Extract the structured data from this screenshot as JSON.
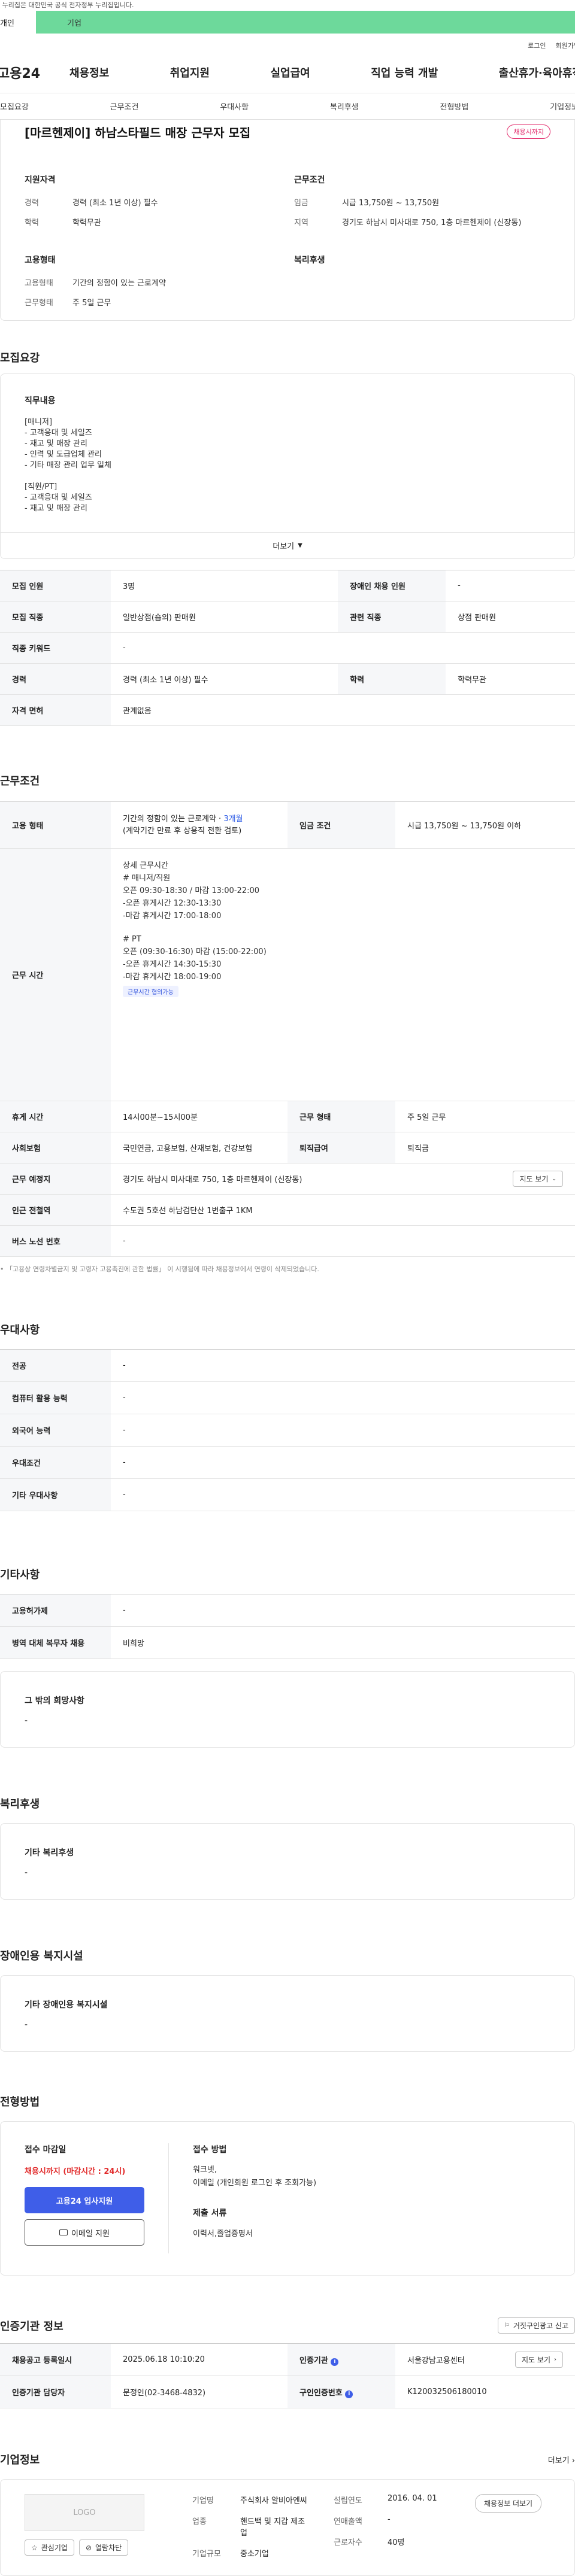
{
  "topbar": {
    "notice": "이 누리집은 대한민국 공식 전자정부 누리집입니다."
  },
  "tabs": [
    {
      "label": "개인"
    },
    {
      "label": "기업"
    }
  ],
  "util": {
    "login": "로그인",
    "join": "회원가입"
  },
  "logo": "고용24",
  "gnb": [
    "채용정보",
    "취업지원",
    "실업급여",
    "직업 능력 개발",
    "출산휴가·육아휴직"
  ],
  "lnb": [
    "모집요강",
    "근무조건",
    "우대사항",
    "복리후생",
    "전형방법",
    "기업정보"
  ],
  "header": {
    "title": "[마르헨제이] 하남스타필드 매장 근무자 모집",
    "badge": "채용시까지",
    "qualification": {
      "title": "지원자격",
      "rows": [
        {
          "label": "경력",
          "value": "경력 (최소 1년 이상) 필수"
        },
        {
          "label": "학력",
          "value": "학력무관"
        }
      ]
    },
    "conditions": {
      "title": "근무조건",
      "rows": [
        {
          "label": "임금",
          "value": "시급 13,750원 ~ 13,750원"
        },
        {
          "label": "지역",
          "value": "경기도 하남시 미사대로 750, 1층 마르헨제이 (신장동)"
        }
      ]
    },
    "employment": {
      "title": "고용형태",
      "rows": [
        {
          "label": "고용형태",
          "value": "기간의 정함이 있는 근로계약"
        },
        {
          "label": "근무형태",
          "value": "주 5일 근무"
        }
      ]
    },
    "welfare": {
      "title": "복리후생"
    }
  },
  "recruit": {
    "title": "모집요강",
    "duty_title": "직무내용",
    "duty_lines": [
      "[매니저]",
      "- 고객응대 및 세일즈",
      "- 재고 및 매장 관리",
      "- 인력 및 도급업체 관리",
      "- 기타 매장 관리 업무 일체",
      "",
      "[직원/PT]",
      "- 고객응대 및 세일즈",
      "- 재고 및 매장 관리"
    ],
    "more": "더보기",
    "table": [
      {
        "k1": "모집 인원",
        "v1": "3명",
        "k2": "장애인 채용 인원",
        "v2": "-"
      },
      {
        "k1": "모집 직종",
        "v1": "일반상점(숍의) 판매원",
        "k2": "관련 직종",
        "v2": "상점 판매원"
      },
      {
        "k1": "직종 키워드",
        "v1": "-",
        "k2": "",
        "v2": ""
      },
      {
        "k1": "경력",
        "v1": "경력 (최소 1년 이상) 필수",
        "k2": "학력",
        "v2": "학력무관"
      },
      {
        "k1": "자격 면허",
        "v1": "관계없음",
        "k2": "",
        "v2": ""
      }
    ]
  },
  "work": {
    "title": "근무조건",
    "contract_label": "고용 형태",
    "contract_value": "기간의 정함이 있는 근로계약 · ",
    "contract_link": "3개월",
    "contract_note": "(계약기간 만료 후 상용직 전환 검토)",
    "wage_label": "임금 조건",
    "wage_value": "시급 13,750원 ~ 13,750원 이하",
    "hours_label": "근무 시간",
    "hours_lines": [
      "상세 근무시간",
      "# 매니저/직원",
      "오픈 09:30-18:30 / 마감 13:00-22:00",
      "-오픈 휴게시간 12:30-13:30",
      "-마감 휴게시간 17:00-18:00",
      "",
      "# PT",
      "오픈 (09:30-16:30) 마감 (15:00-22:00)",
      "-오픈 휴게시간 14:30-15:30",
      "-마감 휴게시간 18:00-19:00"
    ],
    "hours_tag": "근무시간 협의가능",
    "rows": [
      {
        "k1": "휴게 시간",
        "v1": "14시00분~15시00분",
        "k2": "근무 형태",
        "v2": "주 5일 근무"
      },
      {
        "k1": "사회보험",
        "v1": "국민연금, 고용보험, 산재보험, 건강보험",
        "k2": "퇴직급여",
        "v2": "퇴직금"
      }
    ],
    "place_label": "근무 예정지",
    "place_value": "경기도 하남시 미사대로 750, 1층 마르헨제이 (신장동)",
    "map_btn": "지도 보기",
    "station_label": "인근 전철역",
    "station_value": "수도권 5호선 하남검단산 1번출구 1KM",
    "bus_label": "버스 노선 번호",
    "bus_value": "-",
    "footnote": "「고용상 연령차별금지 및 고령자 고용촉진에 관한 법률」 이 시행됨에 따라 채용정보에서 연령이 삭제되었습니다."
  },
  "pref": {
    "title": "우대사항",
    "rows": [
      {
        "k": "전공",
        "v": "-"
      },
      {
        "k": "컴퓨터 활용 능력",
        "v": "-"
      },
      {
        "k": "외국어 능력",
        "v": "-"
      },
      {
        "k": "우대조건",
        "v": "-"
      },
      {
        "k": "기타 우대사항",
        "v": "-"
      }
    ]
  },
  "etc": {
    "title": "기타사항",
    "rows": [
      {
        "k": "고용허가제",
        "v": "-"
      },
      {
        "k": "병역 대체 복무자 채용",
        "v": "비희망"
      }
    ],
    "box_title": "그 밖의 희망사항",
    "box_value": "-"
  },
  "benefit": {
    "title": "복리후생",
    "box_title": "기타 복리후생",
    "box_value": "-"
  },
  "disabled": {
    "title": "장애인용 복지시설",
    "box_title": "기타 장애인용 복지시설",
    "box_value": "-"
  },
  "selection": {
    "title": "전형방법",
    "deadline_title": "접수 마감일",
    "deadline_value": "채용시까지 (마감시간 : 24시)",
    "apply_btn": "고용24 입사지원",
    "email_btn": "이메일 지원",
    "method_title": "접수 방법",
    "method_lines": [
      "워크넷,",
      "이메일 (개인회원 로그인 후 조회가능)"
    ],
    "docs_title": "제출 서류",
    "docs_value": "이력서,졸업증명서"
  },
  "agency": {
    "title": "인증기관 정보",
    "report_btn": "거짓구인광고 신고",
    "rows": [
      {
        "k1": "채용공고 등록일시",
        "v1": "2025.06.18 10:10:20",
        "k2": "인증기관",
        "v2": "서울강남고용센터",
        "btn": "지도 보기"
      },
      {
        "k1": "인증기관 담당자",
        "v1": "문정인(02-3468-4832)",
        "k2": "구인인증번호",
        "v2": "K120032506180010",
        "btn": ""
      }
    ]
  },
  "company": {
    "title": "기업정보",
    "more": "더보기",
    "logo": "LOGO",
    "fav_btn": "관심기업",
    "block_btn": "열람차단",
    "fields": [
      {
        "k": "기업명",
        "v": "주식회사 알비아엔씨"
      },
      {
        "k": "업종",
        "v": "핸드백 및 지갑 제조업"
      },
      {
        "k": "기업규모",
        "v": "중소기업"
      }
    ],
    "fields2": [
      {
        "k": "설립연도",
        "v": "2016. 04. 01"
      },
      {
        "k": "연매출액",
        "v": "-"
      },
      {
        "k": "근로자수",
        "v": "40명"
      }
    ],
    "recruit_btn": "채용정보 더보기"
  }
}
